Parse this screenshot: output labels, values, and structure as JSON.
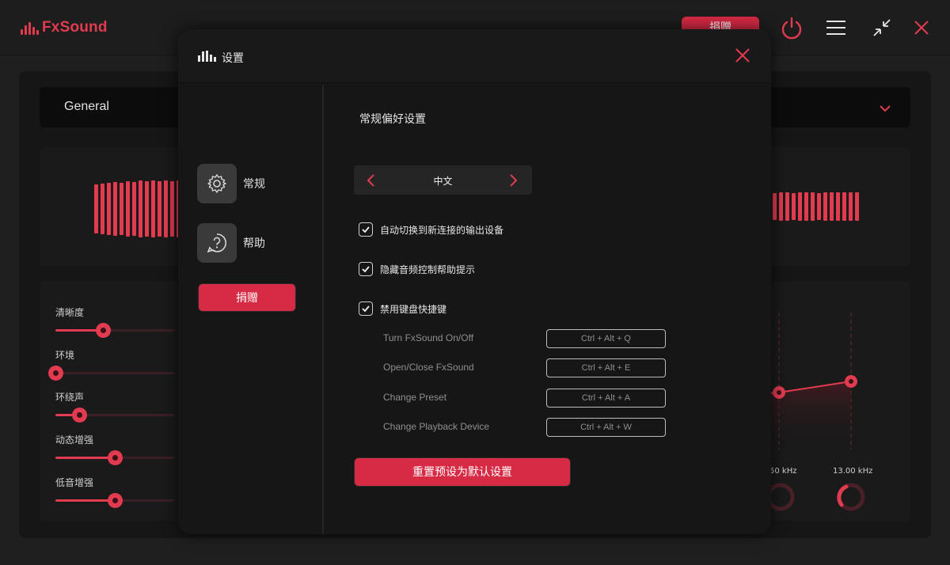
{
  "app": {
    "logo_text": "FxSound",
    "donate_label": "捐赠",
    "preset": {
      "selected": "General"
    },
    "effects": [
      {
        "label": "清晰度",
        "value": 0.4
      },
      {
        "label": "环境",
        "value": 0.0
      },
      {
        "label": "环绕声",
        "value": 0.2
      },
      {
        "label": "动态增强",
        "value": 0.5
      },
      {
        "label": "低音增强",
        "value": 0.5
      }
    ],
    "eq": {
      "visible_bands": [
        "50 kHz",
        "13.00 kHz"
      ]
    },
    "colors": {
      "accent": "#d72a44",
      "background": "#1f1f1f"
    }
  },
  "dialog": {
    "title": "设置",
    "nav": [
      {
        "label": "常规",
        "icon": "gear-icon"
      },
      {
        "label": "帮助",
        "icon": "help-icon"
      }
    ],
    "nav_donate_label": "捐赠",
    "general": {
      "section_title": "常规偏好设置",
      "language": {
        "value": "中文"
      },
      "options": [
        {
          "label": "自动切换到新连接的输出设备",
          "checked": true
        },
        {
          "label": "隐藏音频控制帮助提示",
          "checked": true
        },
        {
          "label": "禁用键盘快捷键",
          "checked": true
        }
      ],
      "hotkeys": [
        {
          "label": "Turn FxSound On/Off",
          "keys": "Ctrl +  Alt + Q"
        },
        {
          "label": "Open/Close FxSound",
          "keys": "Ctrl +  Alt + E"
        },
        {
          "label": "Change Preset",
          "keys": "Ctrl +  Alt + A"
        },
        {
          "label": "Change Playback Device",
          "keys": "Ctrl +  Alt + W"
        }
      ],
      "reset_label": "重置预设为默认设置"
    }
  }
}
